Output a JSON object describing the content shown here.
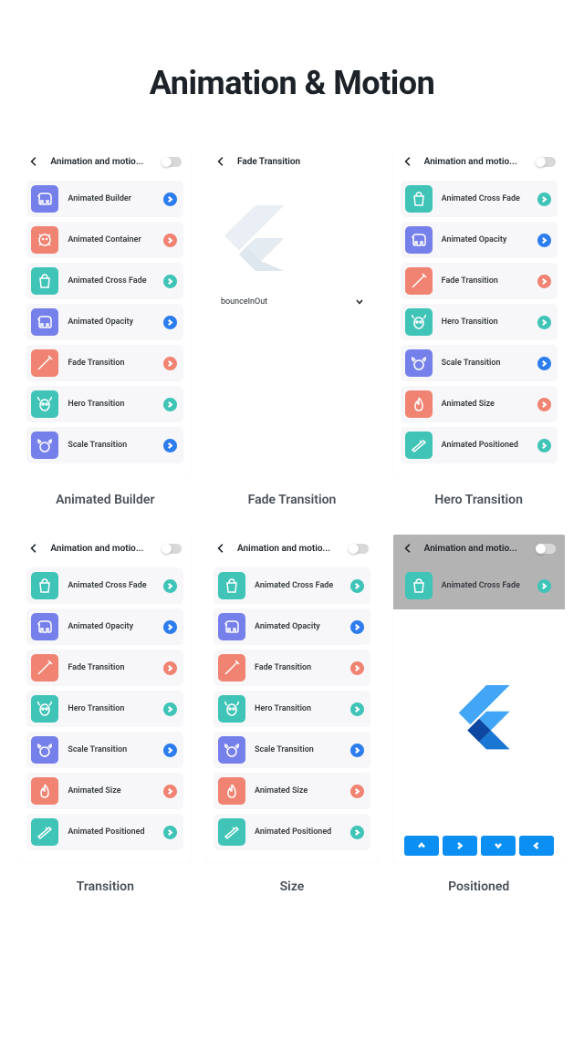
{
  "title": "Animation & Motion",
  "captions": [
    "Animated Builder",
    "Fade Transition",
    "Hero Transition",
    "Transition",
    "Size",
    "Positioned"
  ],
  "appbar": {
    "list_title": "Animation and motio...",
    "detail_title": "Fade Transition"
  },
  "dropdown_label": "bounceInOut",
  "listA": [
    {
      "icon": "elephant",
      "color": "purple",
      "label": "Animated Builder",
      "chev": "blue"
    },
    {
      "icon": "lion",
      "color": "salmon",
      "label": "Animated Container",
      "chev": "salmon"
    },
    {
      "icon": "bag",
      "color": "teal",
      "label": "Animated Cross Fade",
      "chev": "teal"
    },
    {
      "icon": "elephant",
      "color": "purple",
      "label": "Animated Opacity",
      "chev": "blue"
    },
    {
      "icon": "pen",
      "color": "salmon",
      "label": "Fade Transition",
      "chev": "salmon"
    },
    {
      "icon": "cow",
      "color": "teal",
      "label": "Hero Transition",
      "chev": "teal"
    },
    {
      "icon": "buffalo",
      "color": "purple",
      "label": "Scale Transition",
      "chev": "blue"
    }
  ],
  "listB": [
    {
      "icon": "bag",
      "color": "teal",
      "label": "Animated Cross Fade",
      "chev": "teal"
    },
    {
      "icon": "elephant",
      "color": "purple",
      "label": "Animated Opacity",
      "chev": "blue"
    },
    {
      "icon": "pen",
      "color": "salmon",
      "label": "Fade Transition",
      "chev": "salmon"
    },
    {
      "icon": "cow",
      "color": "teal",
      "label": "Hero Transition",
      "chev": "teal"
    },
    {
      "icon": "buffalo",
      "color": "purple",
      "label": "Scale Transition",
      "chev": "blue"
    },
    {
      "icon": "fire",
      "color": "salmon",
      "label": "Animated Size",
      "chev": "salmon"
    },
    {
      "icon": "rifle",
      "color": "teal",
      "label": "Animated Positioned",
      "chev": "teal"
    }
  ],
  "listC_first_label": "Animated Cross Fade"
}
